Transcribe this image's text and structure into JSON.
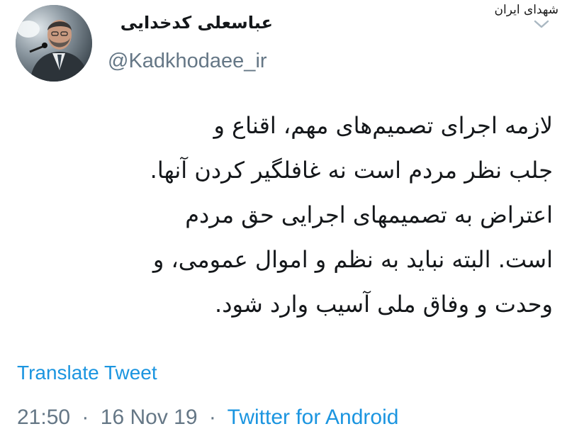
{
  "watermark": "شهدای ایران",
  "author": {
    "display_name": "عباسعلی کدخدایی",
    "handle": "@Kadkhodaee_ir"
  },
  "tweet": {
    "lines": [
      "لازمه اجرای تصمیم‌های مهم، اقناع و",
      "جلب نظر مردم است نه غافلگیر کردن آنها.",
      "اعتراض به تصمیمهای اجرایی حق مردم",
      "است. البته نباید به نظم و اموال عمومی، و",
      "وحدت و وفاق ملی آسیب وارد شود."
    ]
  },
  "translate_label": "Translate Tweet",
  "meta": {
    "time": "21:50",
    "date": "16 Nov 19",
    "separator": "·",
    "source": "Twitter for Android"
  },
  "colors": {
    "link": "#1b95e0",
    "secondary": "#657786",
    "text": "#14171a"
  },
  "icons": {
    "caret": "chevron-down-icon"
  }
}
